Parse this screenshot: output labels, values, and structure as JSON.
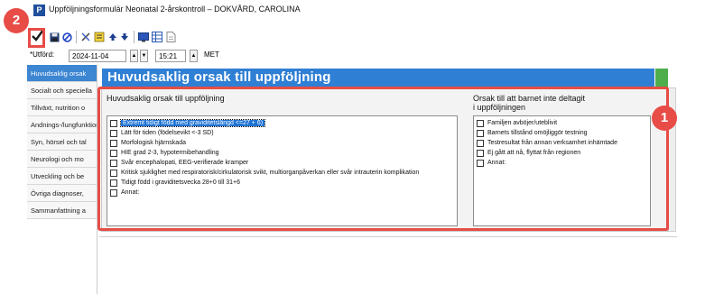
{
  "window": {
    "app_icon_letter": "P",
    "title": "Uppföljningsformulär Neonatal  2-årskontroll – DOKVÅRD, CAROLINA"
  },
  "toolbar": {
    "buttons": [
      "checkmark-icon",
      "save-icon",
      "cancel-icon",
      "tools-icon",
      "notes-icon",
      "arrow-up-icon",
      "arrow-down-icon",
      "monitor-icon",
      "grid-icon",
      "document-icon"
    ]
  },
  "callouts": {
    "first": "1",
    "second": "2"
  },
  "form": {
    "date_label": "*Utförd:",
    "date_value": "2024-11-04",
    "time_value": "15:21",
    "met_label": "MET"
  },
  "sidebar": {
    "items": [
      "Huvudsaklig orsak",
      "Socialt och speciella",
      "Tillväxt, nutrition o",
      "Andnings-/lungfunktion",
      "Syn, hörsel och tal",
      "Neurologi och mo",
      "Utveckling och be",
      "Övriga diagnoser,",
      "Sammanfattning a"
    ]
  },
  "main": {
    "header": "Huvudsaklig orsak till uppföljning",
    "left_section_title": "Huvudsaklig orsak till uppföljning",
    "left_options": [
      "Extremt tidigt född med graviditetslängd <=27 + 6)",
      "Lätt för tiden (födelsevikt <-3 SD)",
      "Morfologisk hjärnskada",
      "HIE grad 2-3, hypotermibehandling",
      "Svår encephalopati, EEG-verifierade kramper",
      "Kritisk sjuklighet med respiratorisk/cirkulatorisk svikt, multiorganpåverkan eller svår intrauterin komplikation",
      "Tidigt född i graviditetsvecka 28+0 till 31+6",
      "Annat:"
    ],
    "right_section_title_line1": "Orsak till att barnet inte deltagit",
    "right_section_title_line2": "i uppföljningen",
    "right_options": [
      "Familjen avböjer/uteblivit",
      "Barnets tillstånd omöjliggör testning",
      "Testresultat från annan verksamhet inhämtade",
      "Ej gått att nå, flyttat från regionen",
      "Annat:"
    ]
  }
}
